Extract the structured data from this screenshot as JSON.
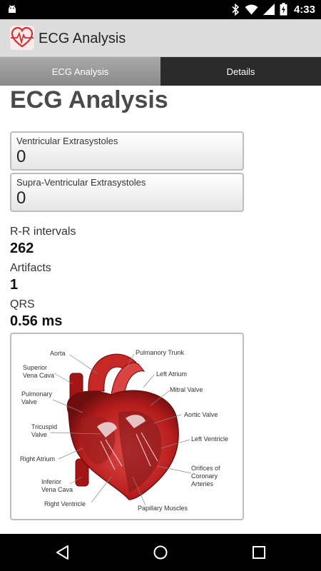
{
  "status_bar": {
    "time": "4:33",
    "icons": [
      "android-icon",
      "bluetooth-icon",
      "wifi-icon",
      "signal-icon",
      "battery-icon"
    ]
  },
  "app_bar": {
    "title": "ECG Analysis",
    "logo": "heart-ecg-logo"
  },
  "tabs": [
    {
      "label": "ECG Analysis",
      "active": true
    },
    {
      "label": "Details",
      "active": false
    }
  ],
  "main": {
    "heading": "ECG Analysis",
    "cards": [
      {
        "label": "Ventricular Extrasystoles",
        "value": "0"
      },
      {
        "label": "Supra-Ventricular Extrasystoles",
        "value": "0"
      }
    ],
    "stats": [
      {
        "label": "R-R intervals",
        "value": "262"
      },
      {
        "label": "Artifacts",
        "value": "1"
      },
      {
        "label": "QRS",
        "value": "0.56 ms"
      }
    ]
  },
  "heart_diagram": {
    "labels": {
      "aorta": "Aorta",
      "pulmonary_trunk": "Pulmanory Trunk",
      "superior_vena_cava": "Superior\nVena Cava",
      "left_atrium": "Left Atrium",
      "mitral_valve": "Mitral Valve",
      "pulmonary_valve": "Pulmonary\nValve",
      "aortic_valve": "Aortic Valve",
      "tricuspid_valve": "Tricuspid\nValve",
      "left_ventricle": "Left Ventricle",
      "right_atrium": "Right Atrium",
      "orifices": "Orifices of\nCoronary\nArteries",
      "inferior_vena_cava": "Inferior\nVena Cava",
      "right_ventricle": "Right Ventricle",
      "papillary_muscles": "Papillary Muscles"
    }
  },
  "nav_bar": {
    "buttons": [
      "back-icon",
      "home-icon",
      "recents-icon"
    ]
  },
  "colors": {
    "status_bar": "#000000",
    "app_bar": "#dcdcdc",
    "tab_active": "#9a9a9a",
    "tab_inactive": "#2a2a2a",
    "heart_red": "#b71c1c"
  }
}
